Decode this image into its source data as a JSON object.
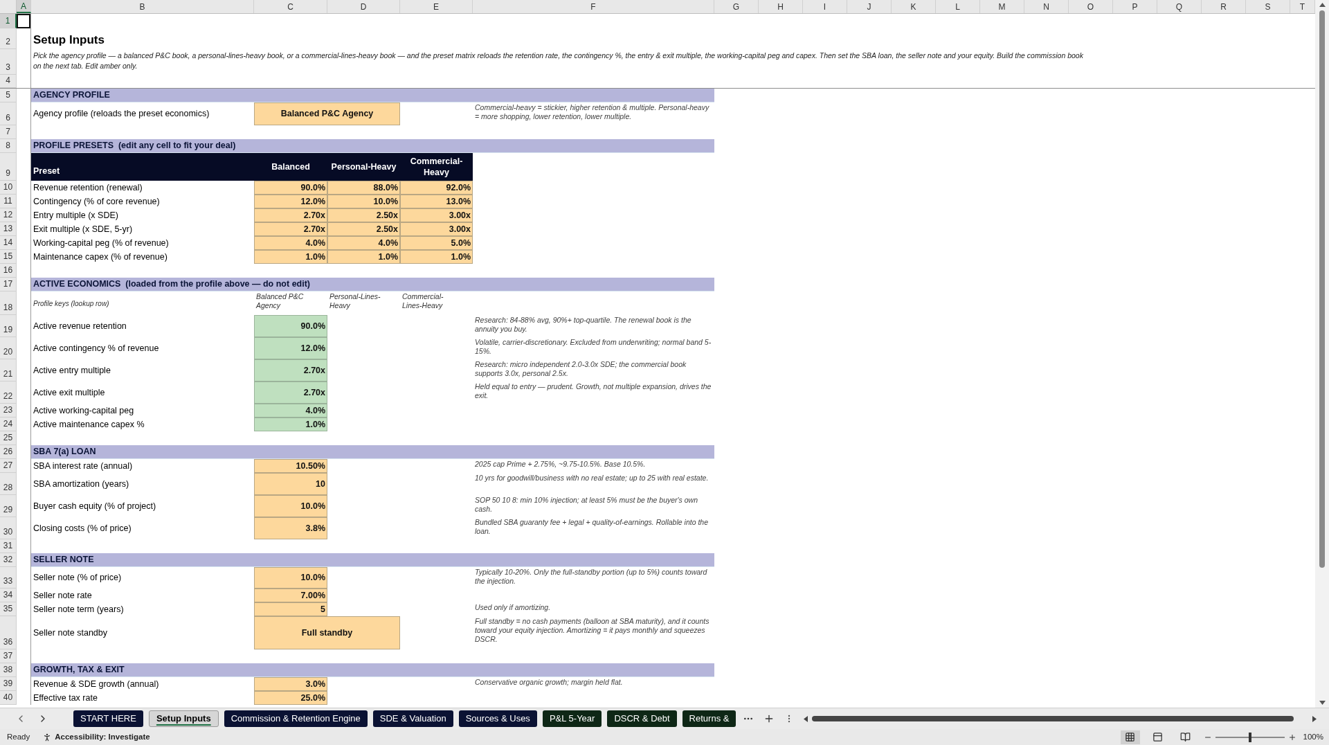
{
  "columns": [
    {
      "label": "A",
      "selected": true
    },
    {
      "label": "B",
      "selected": false
    },
    {
      "label": "C",
      "selected": false
    },
    {
      "label": "D",
      "selected": false
    },
    {
      "label": "E",
      "selected": false
    },
    {
      "label": "F",
      "selected": false
    },
    {
      "label": "G",
      "selected": false
    },
    {
      "label": "H",
      "selected": false
    },
    {
      "label": "I",
      "selected": false
    },
    {
      "label": "J",
      "selected": false
    },
    {
      "label": "K",
      "selected": false
    },
    {
      "label": "L",
      "selected": false
    },
    {
      "label": "M",
      "selected": false
    },
    {
      "label": "N",
      "selected": false
    },
    {
      "label": "O",
      "selected": false
    },
    {
      "label": "P",
      "selected": false
    },
    {
      "label": "Q",
      "selected": false
    },
    {
      "label": "R",
      "selected": false
    },
    {
      "label": "S",
      "selected": false
    },
    {
      "label": "T",
      "selected": false
    }
  ],
  "rows": [
    {
      "number": "1",
      "selected": true,
      "kind": "blank"
    },
    {
      "number": "2",
      "selected": false,
      "kind": "title",
      "text": "Setup Inputs"
    },
    {
      "number": "3",
      "selected": false,
      "kind": "intro",
      "text": "Pick the agency profile — a balanced P&C book, a personal-lines-heavy book, or a commercial-lines-heavy book — and the preset matrix reloads the retention rate, the contingency %, the entry & exit multiple, the working-capital peg and capex. Then set the SBA loan, the seller note and your equity. Build the commission book on the next tab. Edit amber only."
    },
    {
      "number": "4",
      "selected": false,
      "kind": "blank"
    },
    {
      "number": "5",
      "selected": false,
      "kind": "section",
      "text": "AGENCY PROFILE"
    },
    {
      "number": "6",
      "selected": false,
      "kind": "dropdown",
      "label": "Agency profile (reloads the preset economics)",
      "value": "Balanced P&C Agency",
      "note": "Commercial-heavy = stickier, higher retention & multiple. Personal-heavy = more shopping, lower retention, lower multiple."
    },
    {
      "number": "7",
      "selected": false,
      "kind": "blank"
    },
    {
      "number": "8",
      "selected": false,
      "kind": "section",
      "text": "PROFILE PRESETS  (edit any cell to fit your deal)"
    },
    {
      "number": "9",
      "selected": false,
      "kind": "table_header",
      "cells": [
        "Preset",
        "Balanced",
        "Personal-Heavy",
        "Commercial-Heavy"
      ]
    },
    {
      "number": "10",
      "selected": false,
      "kind": "preset",
      "label": "Revenue retention (renewal)",
      "values": [
        "90.0%",
        "88.0%",
        "92.0%"
      ]
    },
    {
      "number": "11",
      "selected": false,
      "kind": "preset",
      "label": "Contingency (% of core revenue)",
      "values": [
        "12.0%",
        "10.0%",
        "13.0%"
      ]
    },
    {
      "number": "12",
      "selected": false,
      "kind": "preset",
      "label": "Entry multiple (x SDE)",
      "values": [
        "2.70x",
        "2.50x",
        "3.00x"
      ]
    },
    {
      "number": "13",
      "selected": false,
      "kind": "preset",
      "label": "Exit multiple (x SDE, 5-yr)",
      "values": [
        "2.70x",
        "2.50x",
        "3.00x"
      ]
    },
    {
      "number": "14",
      "selected": false,
      "kind": "preset",
      "label": "Working-capital peg (% of revenue)",
      "values": [
        "4.0%",
        "4.0%",
        "5.0%"
      ]
    },
    {
      "number": "15",
      "selected": false,
      "kind": "preset",
      "label": "Maintenance capex (% of revenue)",
      "values": [
        "1.0%",
        "1.0%",
        "1.0%"
      ]
    },
    {
      "number": "16",
      "selected": false,
      "kind": "blank"
    },
    {
      "number": "17",
      "selected": false,
      "kind": "section",
      "text": "ACTIVE ECONOMICS  (loaded from the profile above — do not edit)"
    },
    {
      "number": "18",
      "selected": false,
      "kind": "keys",
      "label": "Profile keys (lookup row)",
      "values": [
        "Balanced P&C Agency",
        "Personal-Lines-Heavy",
        "Commercial-Lines-Heavy"
      ]
    },
    {
      "number": "19",
      "selected": false,
      "kind": "output",
      "label": "Active revenue retention",
      "value": "90.0%",
      "note": "Research: 84-88% avg, 90%+ top-quartile. The renewal book is the annuity you buy."
    },
    {
      "number": "20",
      "selected": false,
      "kind": "output",
      "label": "Active contingency % of revenue",
      "value": "12.0%",
      "note": "Volatile, carrier-discretionary. Excluded from underwriting; normal band 5-15%."
    },
    {
      "number": "21",
      "selected": false,
      "kind": "output",
      "label": "Active entry multiple",
      "value": "2.70x",
      "note": "Research: micro independent 2.0-3.0x SDE; the commercial book supports 3.0x, personal 2.5x."
    },
    {
      "number": "22",
      "selected": false,
      "kind": "output",
      "label": "Active exit multiple",
      "value": "2.70x",
      "note": "Held equal to entry — prudent. Growth, not multiple expansion, drives the exit."
    },
    {
      "number": "23",
      "selected": false,
      "kind": "output",
      "label": "Active working-capital peg",
      "value": "4.0%"
    },
    {
      "number": "24",
      "selected": false,
      "kind": "output",
      "label": "Active maintenance capex %",
      "value": "1.0%"
    },
    {
      "number": "25",
      "selected": false,
      "kind": "blank"
    },
    {
      "number": "26",
      "selected": false,
      "kind": "section",
      "text": "SBA 7(a) LOAN"
    },
    {
      "number": "27",
      "selected": false,
      "kind": "input",
      "label": "SBA interest rate (annual)",
      "value": "10.50%",
      "note": "2025 cap Prime + 2.75%, ~9.75-10.5%. Base 10.5%."
    },
    {
      "number": "28",
      "selected": false,
      "kind": "input",
      "label": "SBA amortization (years)",
      "value": "10",
      "note": "10 yrs for goodwill/business with no real estate; up to 25 with real estate."
    },
    {
      "number": "29",
      "selected": false,
      "kind": "input",
      "label": "Buyer cash equity (% of project)",
      "value": "10.0%",
      "note": "SOP 50 10 8: min 10% injection; at least 5% must be the buyer's own cash."
    },
    {
      "number": "30",
      "selected": false,
      "kind": "input",
      "label": "Closing costs (% of price)",
      "value": "3.8%",
      "note": "Bundled SBA guaranty fee + legal + quality-of-earnings. Rollable into the loan."
    },
    {
      "number": "31",
      "selected": false,
      "kind": "blank"
    },
    {
      "number": "32",
      "selected": false,
      "kind": "section",
      "text": "SELLER NOTE"
    },
    {
      "number": "33",
      "selected": false,
      "kind": "input",
      "label": "Seller note (% of price)",
      "value": "10.0%",
      "note": "Typically 10-20%. Only the full-standby portion (up to 5%) counts toward the injection."
    },
    {
      "number": "34",
      "selected": false,
      "kind": "input",
      "label": "Seller note rate",
      "value": "7.00%"
    },
    {
      "number": "35",
      "selected": false,
      "kind": "input",
      "label": "Seller note term (years)",
      "value": "5",
      "note": "Used only if amortizing."
    },
    {
      "number": "36",
      "selected": false,
      "kind": "dropdown",
      "label": "Seller note standby",
      "value": "Full standby",
      "note": "Full standby = no cash payments (balloon at SBA maturity), and it counts toward your equity injection. Amortizing = it pays monthly and squeezes DSCR."
    },
    {
      "number": "37",
      "selected": false,
      "kind": "blank"
    },
    {
      "number": "38",
      "selected": false,
      "kind": "section",
      "text": "GROWTH, TAX & EXIT"
    },
    {
      "number": "39",
      "selected": false,
      "kind": "input",
      "label": "Revenue & SDE growth (annual)",
      "value": "3.0%",
      "note": "Conservative organic growth; margin held flat."
    },
    {
      "number": "40",
      "selected": false,
      "kind": "input",
      "label": "Effective tax rate",
      "value": "25.0%"
    }
  ],
  "tabs": [
    {
      "label": "START HERE",
      "selected": false,
      "color": "#0b1233"
    },
    {
      "label": "Setup Inputs",
      "selected": true
    },
    {
      "label": "Commission & Retention Engine",
      "selected": false,
      "color": "#0b1233"
    },
    {
      "label": "SDE & Valuation",
      "selected": false,
      "color": "#0b1233"
    },
    {
      "label": "Sources & Uses",
      "selected": false,
      "color": "#0b1233"
    },
    {
      "label": "P&L 5-Year",
      "selected": false,
      "color": "#0e2716"
    },
    {
      "label": "DSCR & Debt",
      "selected": false,
      "color": "#0e2716"
    },
    {
      "label": "Returns &",
      "selected": false,
      "color": "#0e2716"
    }
  ],
  "status_bar": {
    "mode": "Ready",
    "accessibility": "Accessibility: Investigate",
    "views": [
      {
        "kind": "normal",
        "selected": true
      },
      {
        "kind": "page_layout",
        "selected": false
      },
      {
        "kind": "page_break",
        "selected": false
      }
    ],
    "zoom_slider": {
      "level": 0.5
    },
    "zoom": "100%"
  }
}
